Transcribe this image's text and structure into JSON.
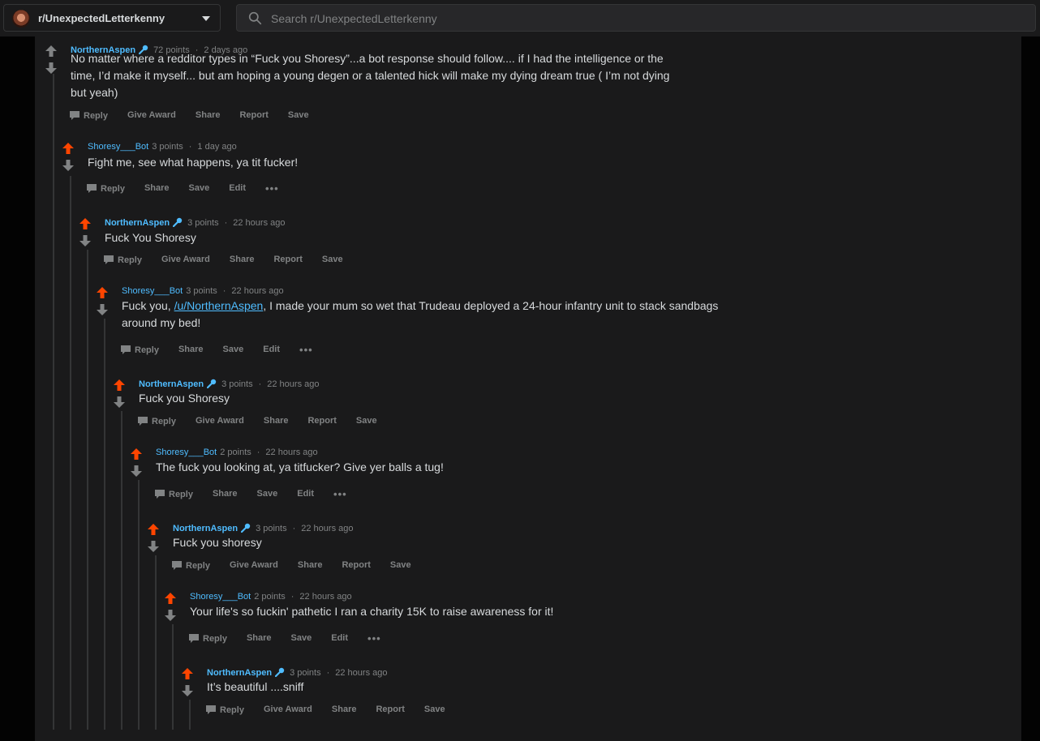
{
  "header": {
    "community": "r/UnexpectedLetterkenny",
    "search_placeholder": "Search r/UnexpectedLetterkenny"
  },
  "colors": {
    "upvoted": "#ff4500",
    "neutral_arrow": "#818384",
    "username": "#4fbcff",
    "panel_bg": "#1a1a1b"
  },
  "comments": [
    {
      "author": "NorthernAspen",
      "points": "72 points",
      "time": "2 days ago",
      "upvoted": false,
      "has_flair": true,
      "lines": [
        "No matter where a redditor types in “Fuck you Shoresy”...a bot response should follow.... if I had the intelligence or the",
        "time, I’d make it myself... but am hoping a young degen or a talented hick will make my dying dream true ( I’m not dying",
        "but yeah)"
      ],
      "actions": [
        "Reply",
        "Give Award",
        "Share",
        "Report",
        "Save"
      ]
    },
    {
      "author": "Shoresy___Bot",
      "points": "3 points",
      "time": "1 day ago",
      "upvoted": true,
      "has_flair": false,
      "lines": [
        "Fight me, see what happens, ya tit fucker!"
      ],
      "actions": [
        "Reply",
        "Share",
        "Save",
        "Edit",
        "•••"
      ]
    },
    {
      "author": "NorthernAspen",
      "points": "3 points",
      "time": "22 hours ago",
      "upvoted": true,
      "has_flair": true,
      "lines": [
        "Fuck You Shoresy"
      ],
      "actions": [
        "Reply",
        "Give Award",
        "Share",
        "Report",
        "Save"
      ]
    },
    {
      "author": "Shoresy___Bot",
      "points": "3 points",
      "time": "22 hours ago",
      "upvoted": true,
      "has_flair": false,
      "lines": [
        "Fuck you, ",
        "around my bed!"
      ],
      "link_text": "/u/NorthernAspen",
      "line1_rest": ", I made your mum so wet that Trudeau deployed a 24-hour infantry unit to stack sandbags",
      "actions": [
        "Reply",
        "Share",
        "Save",
        "Edit",
        "•••"
      ]
    },
    {
      "author": "NorthernAspen",
      "points": "3 points",
      "time": "22 hours ago",
      "upvoted": true,
      "has_flair": true,
      "lines": [
        "Fuck you Shoresy"
      ],
      "actions": [
        "Reply",
        "Give Award",
        "Share",
        "Report",
        "Save"
      ]
    },
    {
      "author": "Shoresy___Bot",
      "points": "2 points",
      "time": "22 hours ago",
      "upvoted": true,
      "has_flair": false,
      "lines": [
        "The fuck you looking at, ya titfucker? Give yer balls a tug!"
      ],
      "actions": [
        "Reply",
        "Share",
        "Save",
        "Edit",
        "•••"
      ]
    },
    {
      "author": "NorthernAspen",
      "points": "3 points",
      "time": "22 hours ago",
      "upvoted": true,
      "has_flair": true,
      "lines": [
        "Fuck you shoresy"
      ],
      "actions": [
        "Reply",
        "Give Award",
        "Share",
        "Report",
        "Save"
      ]
    },
    {
      "author": "Shoresy___Bot",
      "points": "2 points",
      "time": "22 hours ago",
      "upvoted": true,
      "has_flair": false,
      "lines": [
        "Your life's so fuckin' pathetic I ran a charity 15K to raise awareness for it!"
      ],
      "actions": [
        "Reply",
        "Share",
        "Save",
        "Edit",
        "•••"
      ]
    },
    {
      "author": "NorthernAspen",
      "points": "3 points",
      "time": "22 hours ago",
      "upvoted": true,
      "has_flair": true,
      "lines": [
        "It’s beautiful ....sniff"
      ],
      "actions": [
        "Reply",
        "Give Award",
        "Share",
        "Report",
        "Save"
      ]
    }
  ]
}
